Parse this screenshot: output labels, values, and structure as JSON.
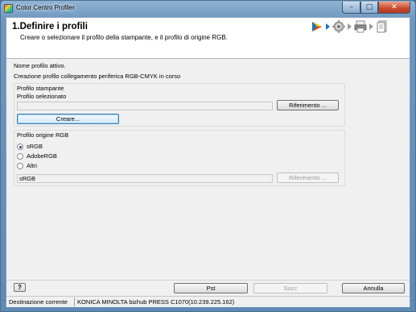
{
  "window": {
    "title": "Color Centro Profiler",
    "controls": {
      "minimize": "–",
      "maximize": "□",
      "close": "✕"
    }
  },
  "header": {
    "step_title": "1.Definire i profili",
    "step_subtitle": "Creare o selezionare il profilo della stampante, e il profilo di origine RGB.",
    "step_icons": [
      "play-step-icon",
      "gear-step-icon",
      "printer-step-icon",
      "document-step-icon"
    ]
  },
  "messages": {
    "active_profile": "Nome profilo attivo.",
    "creating": "Creazione profilo collegamento periferica RGB-CMYK in corso"
  },
  "printer_profile": {
    "group_label": "Profilo stampante",
    "selected_label": "Profilo selezionato",
    "selected_value": "",
    "browse_label": "Riferimento ...",
    "create_label": "Creare..."
  },
  "rgb_profile": {
    "group_label": "Profilo origine RGB",
    "options": [
      {
        "label": "sRGB",
        "selected": true
      },
      {
        "label": "AdobeRGB",
        "selected": false
      },
      {
        "label": "Altri",
        "selected": false
      }
    ],
    "value": "sRGB",
    "browse_label": "Riferimento ..."
  },
  "footer": {
    "help_label": "?",
    "prev_label": "Pst",
    "next_label": "Succ",
    "cancel_label": "Annulla"
  },
  "status": {
    "destination_label": "Destinazione corrente",
    "destination_value": "KONICA MINOLTA bizhub PRESS C1070(10.239.225.162)"
  }
}
